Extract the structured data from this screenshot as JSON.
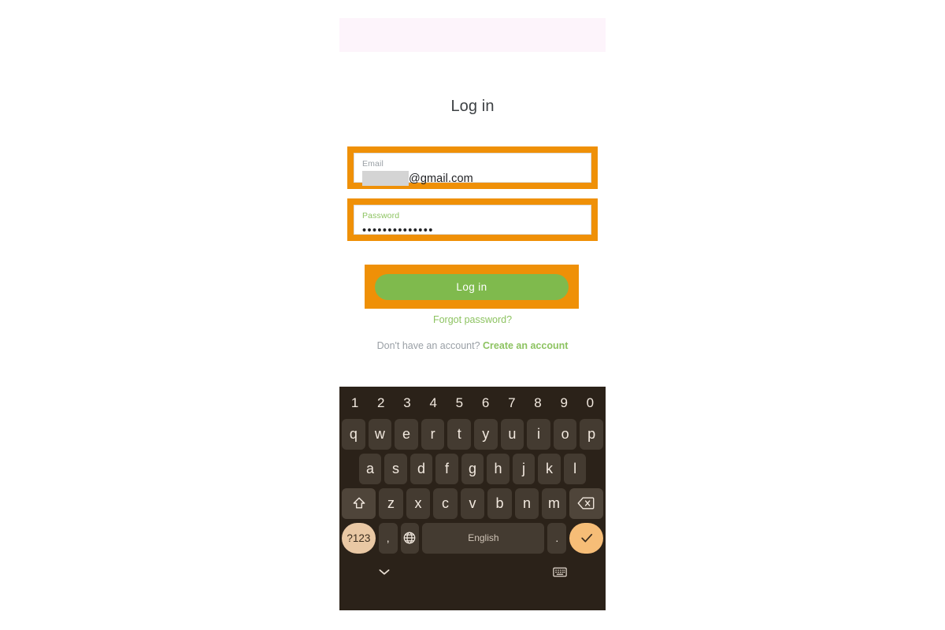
{
  "app": {
    "title": "Log in"
  },
  "form": {
    "email": {
      "label": "Email",
      "value_redacted": true,
      "value_suffix": "@gmail.com",
      "focused": false
    },
    "password": {
      "label": "Password",
      "masked_value": "••••••••••••••",
      "focused": true
    },
    "submit_label": "Log in",
    "forgot_label": "Forgot password?",
    "signup_prompt": "Don't have an account?",
    "signup_link": "Create an account"
  },
  "highlights": {
    "color": "#ef9007",
    "targets": [
      "email-field",
      "password-field",
      "login-button"
    ]
  },
  "colors": {
    "accent_green": "#7fba4d",
    "link_green": "#8dc361",
    "highlight_orange": "#ef9007",
    "keyboard_bg": "#2b2219",
    "key_bg": "#443b31",
    "key_mod_bg": "#4f453a",
    "key_sym_bg": "#e9c8a4",
    "key_enter_bg": "#f6bd77",
    "top_strip": "#fdf4fb"
  },
  "keyboard": {
    "language_label": "English",
    "symbols_label": "?123",
    "rows": {
      "numbers": [
        "1",
        "2",
        "3",
        "4",
        "5",
        "6",
        "7",
        "8",
        "9",
        "0"
      ],
      "top": [
        "q",
        "w",
        "e",
        "r",
        "t",
        "y",
        "u",
        "i",
        "o",
        "p"
      ],
      "home": [
        "a",
        "s",
        "d",
        "f",
        "g",
        "h",
        "j",
        "k",
        "l"
      ],
      "bottom": [
        "z",
        "x",
        "c",
        "v",
        "b",
        "n",
        "m"
      ]
    },
    "comma_label": ",",
    "period_label": ".",
    "icons": {
      "shift": "shift-icon",
      "backspace": "backspace-icon",
      "globe": "globe-icon",
      "enter": "check-icon",
      "hide": "chevron-down-icon",
      "switch": "keyboard-icon"
    }
  }
}
